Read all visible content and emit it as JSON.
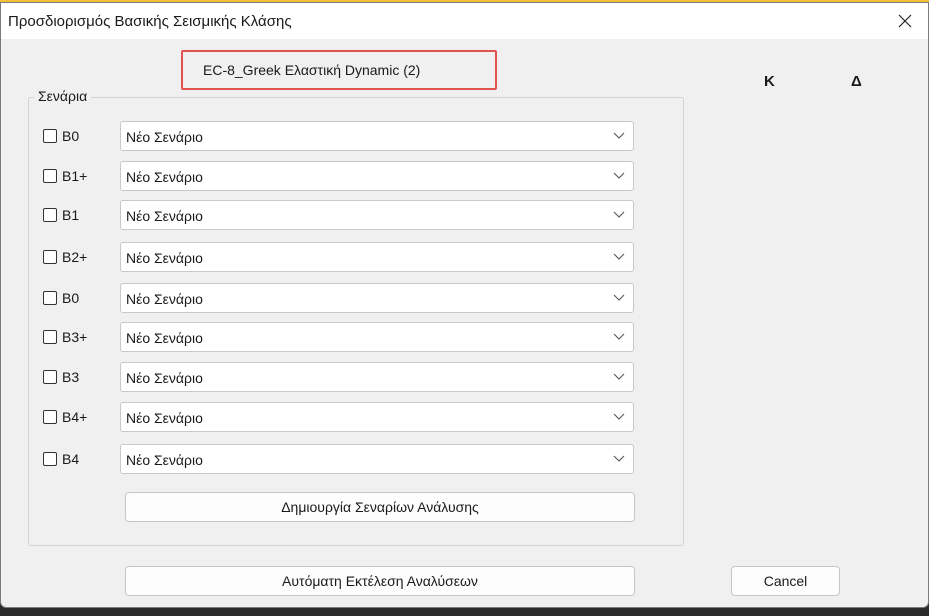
{
  "window": {
    "title": "Προσδιορισμός Βασικής Σεισμικής Κλάσης"
  },
  "header": {
    "analysis_label": "EC-8_Greek Ελαστική Dynamic (2)",
    "col_k": "K",
    "col_d": "Δ"
  },
  "group": {
    "legend": "Σενάρια"
  },
  "rows": [
    {
      "label": "B0",
      "checked": false,
      "value": "Νέο Σενάριο"
    },
    {
      "label": "B1+",
      "checked": false,
      "value": "Νέο Σενάριο"
    },
    {
      "label": "B1",
      "checked": false,
      "value": "Νέο Σενάριο"
    },
    {
      "label": "B2+",
      "checked": false,
      "value": "Νέο Σενάριο"
    },
    {
      "label": "B0",
      "checked": false,
      "value": "Νέο Σενάριο"
    },
    {
      "label": "B3+",
      "checked": false,
      "value": "Νέο Σενάριο"
    },
    {
      "label": "B3",
      "checked": false,
      "value": "Νέο Σενάριο"
    },
    {
      "label": "B4+",
      "checked": false,
      "value": "Νέο Σενάριο"
    },
    {
      "label": "B4",
      "checked": false,
      "value": "Νέο Σενάριο"
    }
  ],
  "buttons": {
    "create": "Δημιουργία Σεναρίων Ανάλυσης",
    "run": "Αυτόματη Εκτέλεση Αναλύσεων",
    "cancel": "Cancel"
  },
  "icons": {
    "close": "close-icon",
    "dropdown": "chevron-down-icon"
  },
  "colors": {
    "highlight_border": "#e0514f"
  }
}
